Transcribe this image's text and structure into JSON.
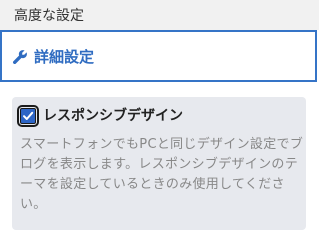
{
  "section": {
    "title": "高度な設定"
  },
  "advanced_link": {
    "label": "詳細設定",
    "icon": "wrench-icon",
    "color": "#2f6cc1"
  },
  "responsive_option": {
    "checked": true,
    "title": "レスポンシブデザイン",
    "description": "スマートフォンでもPCと同じデザイン設定でブログを表示します。レスポンシブデザインのテーマを設定しているときのみ使用してください。"
  }
}
